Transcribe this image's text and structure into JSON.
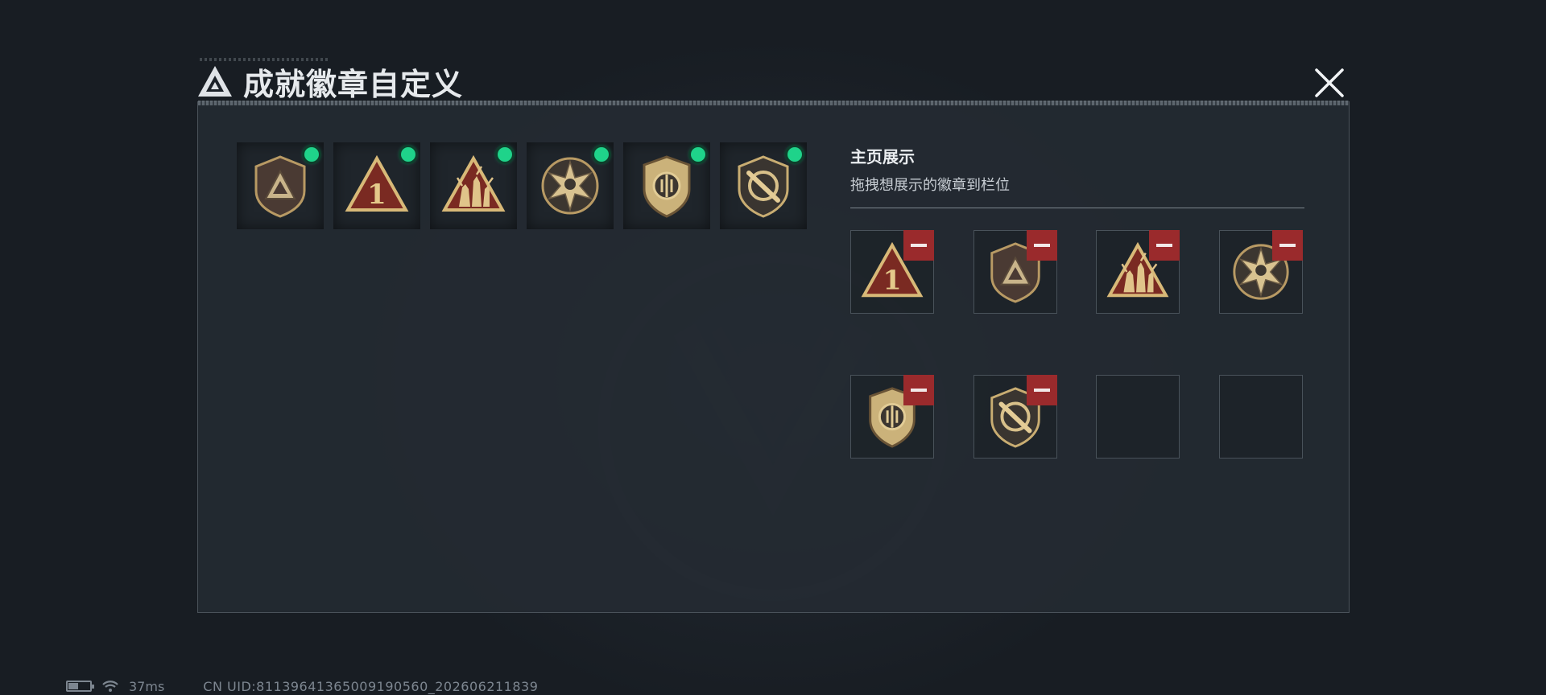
{
  "window": {
    "title": "成就徽章自定义"
  },
  "colors": {
    "accent_green": "#1fd38a",
    "remove_red": "#9a2a2c",
    "panel_bg": "#242a32",
    "badge_gold": "#c9a969"
  },
  "inventory": {
    "badges": [
      {
        "icon": "shield-triangle-badge-icon",
        "equipped": true
      },
      {
        "icon": "number-one-triangle-badge-icon",
        "equipped": true
      },
      {
        "icon": "soldiers-triangle-badge-icon",
        "equipped": true
      },
      {
        "icon": "star-skull-badge-icon",
        "equipped": true
      },
      {
        "icon": "crest-shield-badge-icon",
        "equipped": true
      },
      {
        "icon": "knife-shield-badge-icon",
        "equipped": true
      }
    ]
  },
  "display": {
    "title": "主页展示",
    "subtitle": "拖拽想展示的徽章到栏位",
    "slots": [
      {
        "icon": "number-one-triangle-badge-icon",
        "filled": true
      },
      {
        "icon": "shield-triangle-badge-icon",
        "filled": true
      },
      {
        "icon": "soldiers-triangle-badge-icon",
        "filled": true
      },
      {
        "icon": "star-skull-badge-icon",
        "filled": true
      },
      {
        "icon": "crest-shield-badge-icon",
        "filled": true
      },
      {
        "icon": "knife-shield-badge-icon",
        "filled": true
      },
      {
        "icon": "",
        "filled": false
      },
      {
        "icon": "",
        "filled": false
      }
    ]
  },
  "status": {
    "ping": "37ms",
    "uid": "CN UID:8113964136500919056​0_202606211839"
  }
}
